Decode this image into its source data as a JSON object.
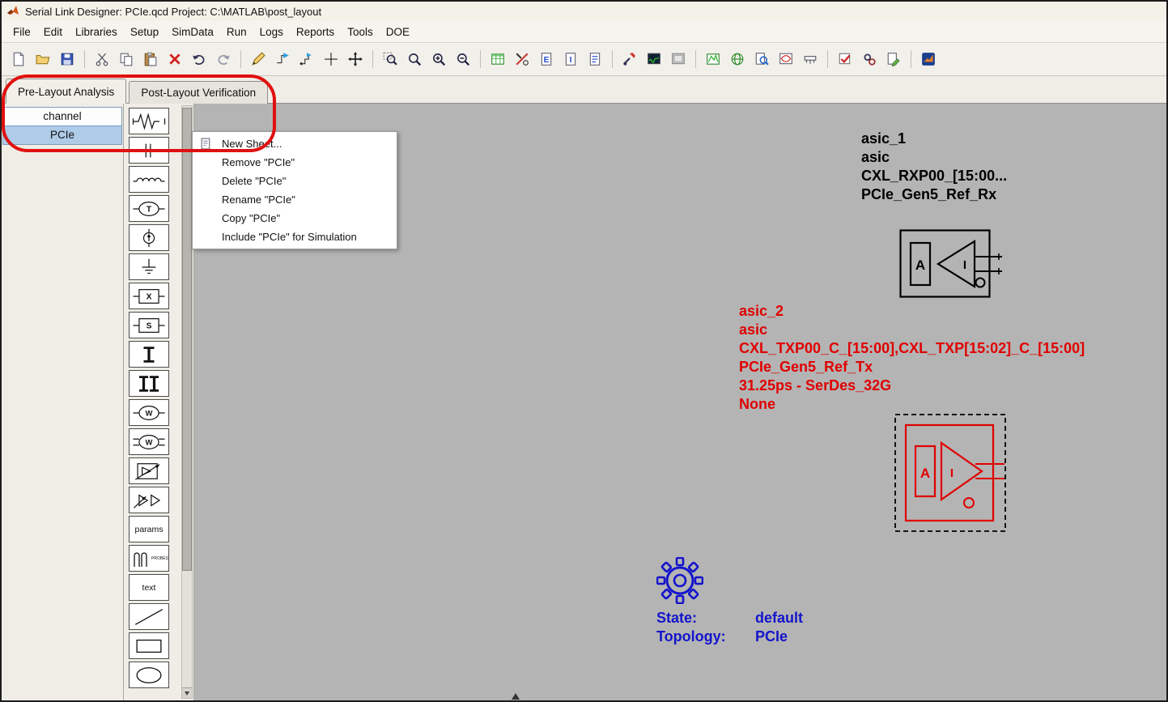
{
  "window": {
    "title": "Serial Link Designer: PCIe.qcd Project: C:\\MATLAB\\post_layout"
  },
  "menu_bar": {
    "items": [
      "File",
      "Edit",
      "Libraries",
      "Setup",
      "SimData",
      "Run",
      "Logs",
      "Reports",
      "Tools",
      "DOE"
    ]
  },
  "toolbar": {
    "icons": [
      "new-sheet",
      "open-project",
      "save-project",
      "cut",
      "copy",
      "paste",
      "delete",
      "undo",
      "redo",
      "draw-wire",
      "connect-net",
      "reroute-net",
      "crosshair",
      "move",
      "zoom-area",
      "zoom-fit",
      "zoom-in",
      "zoom-out",
      "export-spreadsheet",
      "probe-setup",
      "sheet-properties",
      "sheet-info",
      "netlist",
      "simulate",
      "sim-results",
      "transfer-data",
      "waveform-viewer",
      "web-report",
      "inspect-sheet",
      "eye-diagram",
      "measurements",
      "validate",
      "run-manager",
      "edit-settings",
      "matlab"
    ]
  },
  "tab_bar": {
    "tabs": [
      {
        "label": "Pre-Layout Analysis",
        "active": true
      },
      {
        "label": "Post-Layout Verification",
        "active": false
      }
    ]
  },
  "sheet_list": {
    "items": [
      {
        "label": "channel",
        "selected": false
      },
      {
        "label": "PCIe",
        "selected": true
      }
    ]
  },
  "symbol_palette": {
    "items": [
      "resistor",
      "capacitor",
      "inductor",
      "t-element",
      "probe",
      "ground",
      "x-block",
      "s-block",
      "transmission-line",
      "coupled-transmission-line",
      "w-element",
      "coupled-w-element",
      "ibis-buffer",
      "differential-buffer",
      "params",
      "probes",
      "text",
      "line",
      "rectangle",
      "ellipse"
    ],
    "params_label": "params",
    "probes_label": "PROBES",
    "text_label": "text"
  },
  "context_menu": {
    "items": [
      "New Sheet...",
      "Remove \"PCIe\"",
      "Delete \"PCIe\"",
      "Rename \"PCIe\"",
      "Copy \"PCIe\"",
      "Include \"PCIe\" for Simulation"
    ]
  },
  "canvas": {
    "designator_rx": {
      "name": "asic_1",
      "part": "asic",
      "nets": "CXL_RXP00_[15:00...",
      "model": "PCIe_Gen5_Ref_Rx"
    },
    "designator_tx": {
      "name": "asic_2",
      "part": "asic",
      "nets": "CXL_TXP00_C_[15:00],CXL_TXP[15:02]_C_[15:00]",
      "model": "PCIe_Gen5_Ref_Tx",
      "timing": "31.25ps - SerDes_32G",
      "extra": "None"
    },
    "state_block": {
      "state_label": "State:",
      "state_value": "default",
      "topology_label": "Topology:",
      "topology_value": "PCIe"
    }
  },
  "colors": {
    "canvas_bg": "#b4b4b4",
    "selection_fill": "#aecbe8",
    "annotation_red": "#e01010",
    "rx_symbol": "#000000",
    "tx_symbol": "#e00000",
    "state_blue": "#1414cc"
  }
}
